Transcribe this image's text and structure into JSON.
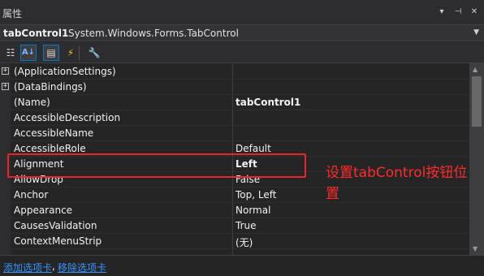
{
  "panel": {
    "title": "属性",
    "controls": [
      "▾",
      "⊣",
      "✕"
    ]
  },
  "object_selector": {
    "name": "tabControl1",
    "type": "System.Windows.Forms.TabControl",
    "dropdown_icon": "chevron-down-icon"
  },
  "toolbar": {
    "buttons": [
      {
        "icon": "categorized-icon",
        "glyph": "☷",
        "active": false
      },
      {
        "icon": "alphabetical-icon",
        "glyph": "A↓",
        "active": true
      },
      {
        "icon": "properties-icon",
        "glyph": "▤",
        "active": true
      },
      {
        "icon": "events-icon",
        "glyph": "⚡",
        "active": false
      },
      {
        "icon": "property-pages-icon",
        "glyph": "🔧",
        "active": false
      }
    ]
  },
  "properties": [
    {
      "name": "(ApplicationSettings)",
      "value": "",
      "expandable": true,
      "bold": false
    },
    {
      "name": "(DataBindings)",
      "value": "",
      "expandable": true,
      "bold": false
    },
    {
      "name": "(Name)",
      "value": "tabControl1",
      "expandable": false,
      "bold": true
    },
    {
      "name": "AccessibleDescription",
      "value": "",
      "expandable": false,
      "bold": false
    },
    {
      "name": "AccessibleName",
      "value": "",
      "expandable": false,
      "bold": false
    },
    {
      "name": "AccessibleRole",
      "value": "Default",
      "expandable": false,
      "bold": false
    },
    {
      "name": "Alignment",
      "value": "Left",
      "expandable": false,
      "bold": true
    },
    {
      "name": "AllowDrop",
      "value": "False",
      "expandable": false,
      "bold": false
    },
    {
      "name": "Anchor",
      "value": "Top, Left",
      "expandable": false,
      "bold": false
    },
    {
      "name": "Appearance",
      "value": "Normal",
      "expandable": false,
      "bold": false
    },
    {
      "name": "CausesValidation",
      "value": "True",
      "expandable": false,
      "bold": false
    },
    {
      "name": "ContextMenuStrip",
      "value": "(无)",
      "expandable": false,
      "bold": false
    },
    {
      "name": "",
      "value": "",
      "expandable": false,
      "bold": false
    }
  ],
  "annotation": {
    "text": "设置tabControl按钮位置",
    "color": "#ff2a2a"
  },
  "links": {
    "add_tab": "添加选项卡",
    "separator": ",",
    "remove_tab": "移除选项卡"
  },
  "colors": {
    "background": "#252526",
    "link": "#3794ff",
    "highlight_border": "#e8262a"
  }
}
